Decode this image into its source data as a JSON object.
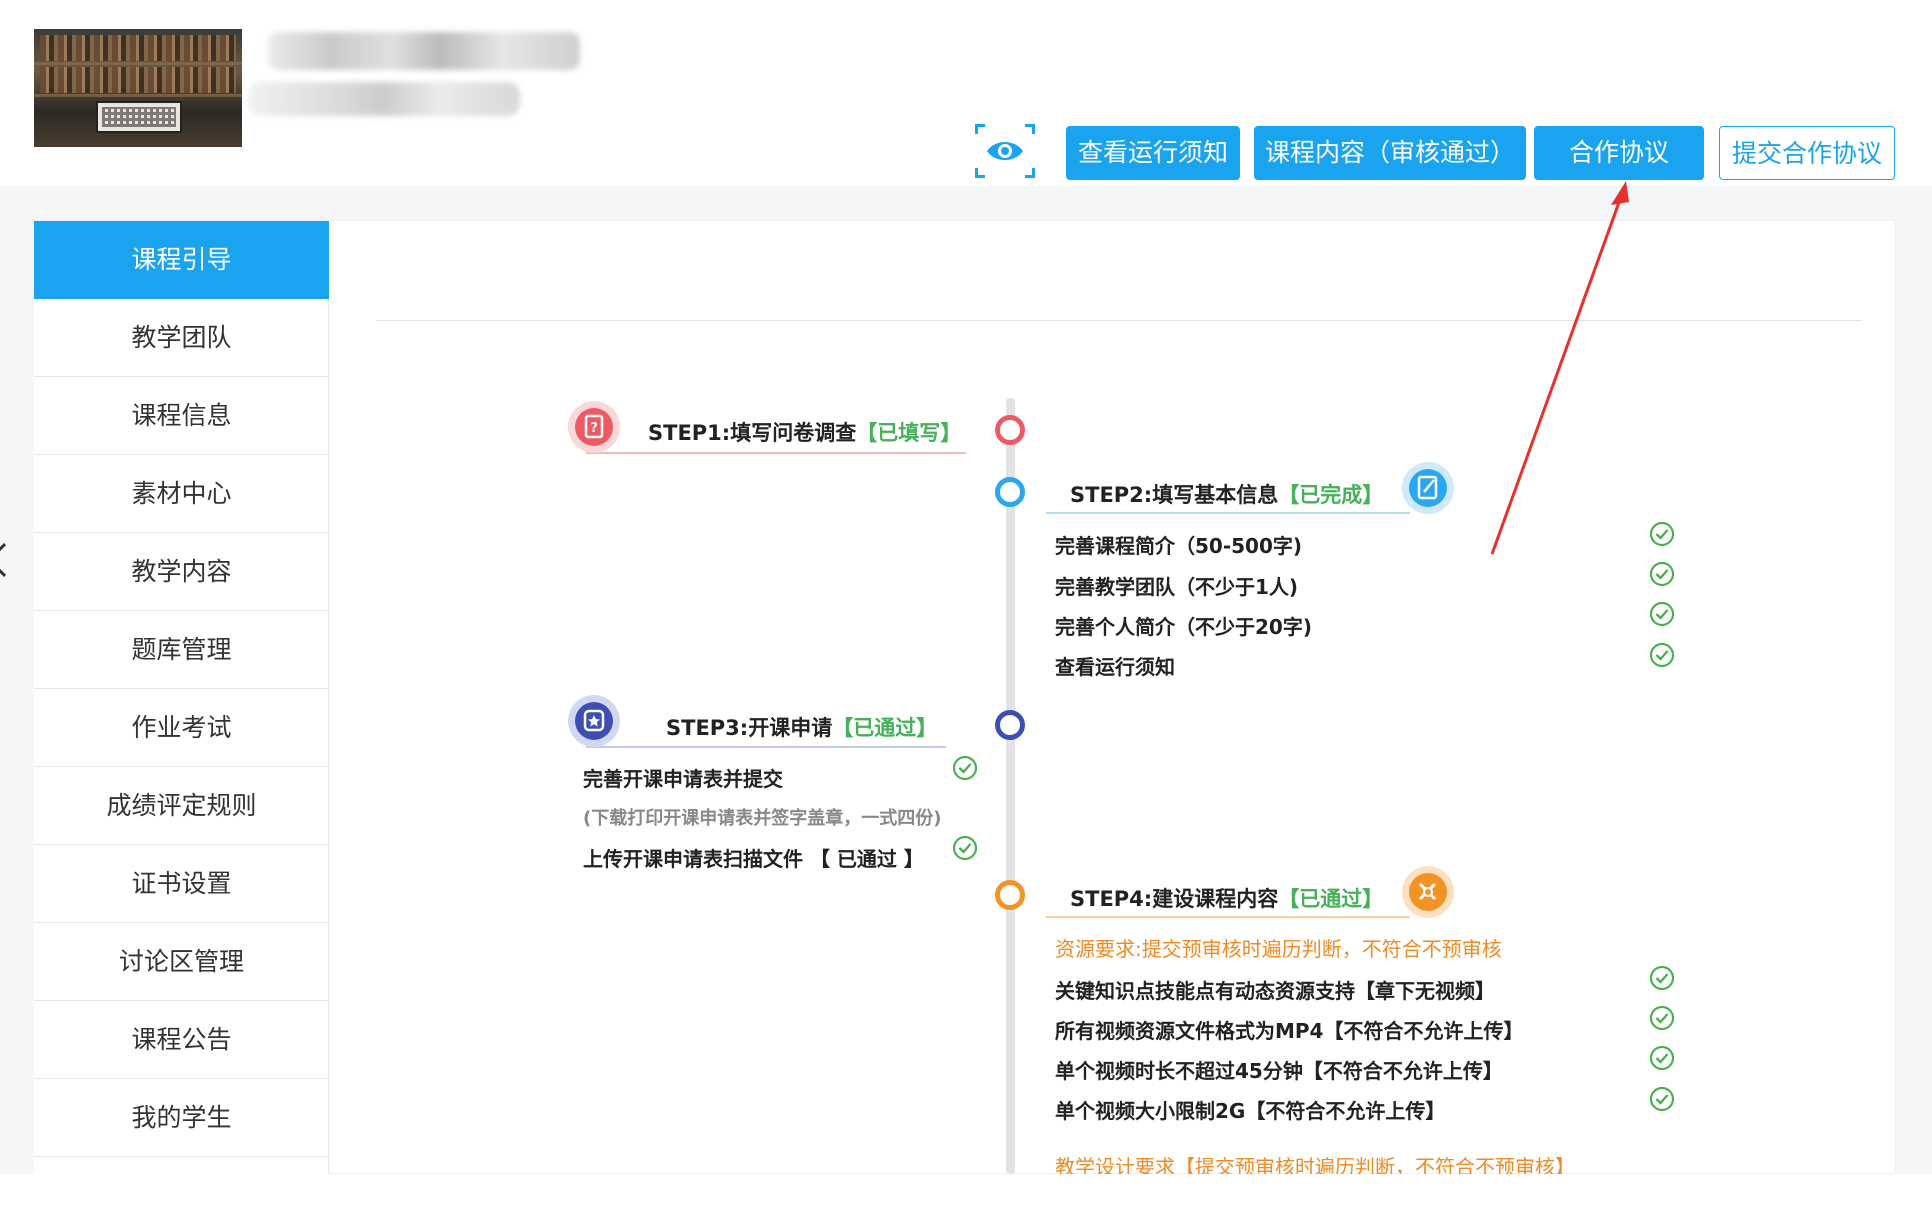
{
  "header": {
    "actions": {
      "view_notice": "查看运行须知",
      "course_content": "课程内容（审核通过）",
      "agreement": "合作协议",
      "submit_agreement": "提交合作协议"
    }
  },
  "sidebar": {
    "items": [
      {
        "label": "课程引导",
        "active": true
      },
      {
        "label": "教学团队"
      },
      {
        "label": "课程信息"
      },
      {
        "label": "素材中心"
      },
      {
        "label": "教学内容"
      },
      {
        "label": "题库管理"
      },
      {
        "label": "作业考试"
      },
      {
        "label": "成绩评定规则"
      },
      {
        "label": "证书设置"
      },
      {
        "label": "讨论区管理"
      },
      {
        "label": "课程公告"
      },
      {
        "label": "我的学生"
      }
    ]
  },
  "steps": {
    "step1": {
      "title": "STEP1:填写问卷调查",
      "status": "【已填写】"
    },
    "step2": {
      "title": "STEP2:填写基本信息",
      "status": "【已完成】",
      "items": [
        "完善课程简介（50-500字)",
        "完善教学团队（不少于1人)",
        "完善个人简介（不少于20字)",
        "查看运行须知"
      ]
    },
    "step3": {
      "title": "STEP3:开课申请",
      "status": "【已通过】",
      "item1": "完善开课申请表并提交",
      "note": "(下载打印开课申请表并签字盖章，一式四份)",
      "item2": "上传开课申请表扫描文件 【 已通过 】"
    },
    "step4": {
      "title": "STEP4:建设课程内容",
      "status": "【已通过】",
      "requirement": "资源要求:提交预审核时遍历判断，不符合不预审核",
      "items": [
        "关键知识点技能点有动态资源支持【章下无视频】",
        "所有视频资源文件格式为MP4【不符合不允许上传】",
        "单个视频时长不超过45分钟【不符合不允许上传】",
        "单个视频大小限制2G【不符合不允许上传】"
      ],
      "design_requirement": "教学设计要求【提交预审核时遍历判断，不符合不预审核】"
    }
  },
  "colors": {
    "primary": "#1aa3ef",
    "step1": "#ee5a63",
    "step2": "#2aa7ee",
    "step3": "#3d4fb5",
    "step4": "#f39326",
    "status_green": "#46b05a",
    "check_green": "#4caf50",
    "annotation_arrow": "#e8302a"
  },
  "icons": [
    "eye-icon",
    "survey-icon",
    "edit-icon",
    "apply-icon",
    "build-icon",
    "check-circle-icon",
    "chevron-left-icon"
  ]
}
